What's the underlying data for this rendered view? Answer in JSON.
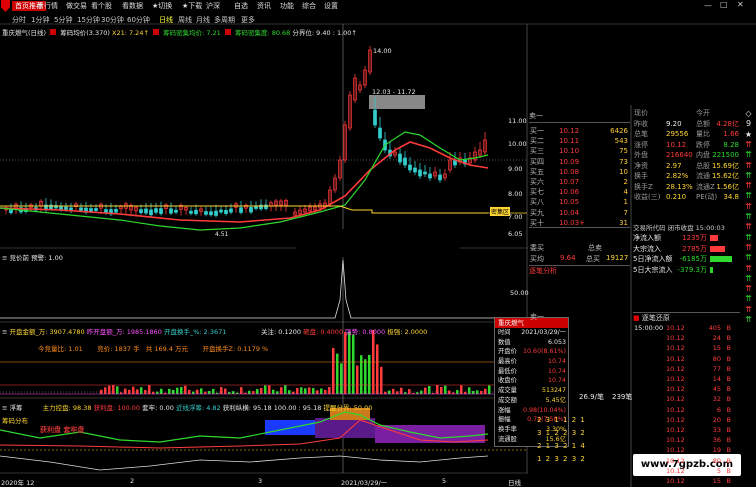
{
  "menu": [
    {
      "label": "首页推荐",
      "active": true
    },
    {
      "label": "看行情",
      "active": false
    },
    {
      "label": "做交易",
      "active": false
    },
    {
      "label": "看个股",
      "active": false
    },
    {
      "label": "看数据",
      "active": false
    },
    {
      "label": "★切换",
      "active": false
    },
    {
      "label": "★下载",
      "active": false
    },
    {
      "label": "沪深",
      "active": false
    },
    {
      "label": "自选",
      "active": false
    },
    {
      "label": "资讯",
      "active": false
    },
    {
      "label": "功能",
      "active": false
    },
    {
      "label": "综合",
      "active": false
    },
    {
      "label": "设置",
      "active": false
    }
  ],
  "periods": [
    "分时",
    "1分钟",
    "5分钟",
    "15分钟",
    "30分钟",
    "60分钟",
    "日线",
    "周线",
    "月线",
    "多周期",
    "更多"
  ],
  "active_period": "日线",
  "main_header": {
    "title": "重庆燃气(日线)",
    "ind1": "筹码均价(3.370)",
    "x21": "X21: 7.24↑",
    "ind2": "筹码密集均价: 7.21",
    "ind3": "筹码密集度: 80.68",
    "fen": "分界位: 9.40 : 1.00↑"
  },
  "price_axis": [
    "11.00",
    "10.00",
    "9.00",
    "8.00",
    "7.00",
    "6.05"
  ],
  "annotations": {
    "high": "14.00",
    "range": "12.03 - 11.72",
    "badge": "密集区",
    "low": "4.51"
  },
  "jingjia": {
    "label": "竞价前",
    "val": "预警: 1.00"
  },
  "axis_50": "50.00",
  "vol_header": {
    "a": "开盘金额_万: 3907.4780",
    "b": "昨开盘额_万: 1985.1860",
    "c": "开盘换手_%: 2.3671",
    "d": "关注: 0.1200",
    "e": "砸盘: 0.4000",
    "f": "强势: 0.8000",
    "g": "极强: 2.0000"
  },
  "vol_sub": {
    "a": "今竞量比: 1.01",
    "b": "竞价: 1837 手",
    "c": "共 169.4 万元",
    "d": "开盘换手Z: 0.1179 %"
  },
  "bot_header": {
    "title": "浮筹",
    "a": "主力控盘: 98.38",
    "b": "获利盘: 100.00",
    "c": "套牢: 0.00",
    "d": "近线浮筹: 4.82",
    "e": "获利纵横: 95.18",
    "f": "100.00 : 95.18",
    "g": "提醒分界: 50.00"
  },
  "bot_left": {
    "a": "筹码分布",
    "b": "获利盘 套牢盘"
  },
  "dates": [
    "2020年 12",
    "2",
    "3",
    "2021/03/29/一",
    "5",
    "日线"
  ],
  "tooltip": {
    "title": "重庆燃气",
    "rows": [
      {
        "k": "时间",
        "v": "2021/03/29/一",
        "c": "wht"
      },
      {
        "k": "数值",
        "v": "6.053",
        "c": "wht"
      },
      {
        "k": "开盘价",
        "v": "10.60(8.61%)",
        "c": "red"
      },
      {
        "k": "最高价",
        "v": "10.74",
        "c": "red"
      },
      {
        "k": "最低价",
        "v": "10.74",
        "c": "red"
      },
      {
        "k": "收盘价",
        "v": "10.74",
        "c": "red"
      },
      {
        "k": "成交量",
        "v": "513247",
        "c": "yel"
      },
      {
        "k": "成交额",
        "v": "5.45亿",
        "c": "yel"
      },
      {
        "k": "涨幅",
        "v": "0.98(10.04%)",
        "c": "red"
      },
      {
        "k": "振幅",
        "v": "0.74(7.58%)",
        "c": "red"
      },
      {
        "k": "换手率",
        "v": "3.30%",
        "c": "yel"
      },
      {
        "k": "流通股",
        "v": "15.6亿",
        "c": "yel"
      }
    ]
  },
  "order_book": {
    "sell_label": "卖一",
    "rows": [
      {
        "l": "买一",
        "p": "10.12",
        "v": "6426"
      },
      {
        "l": "买二",
        "p": "10.11",
        "v": "543"
      },
      {
        "l": "买三",
        "p": "10.10",
        "v": "75"
      },
      {
        "l": "买四",
        "p": "10.09",
        "v": "73"
      },
      {
        "l": "买五",
        "p": "10.08",
        "v": "10"
      },
      {
        "l": "买六",
        "p": "10.07",
        "v": "2"
      },
      {
        "l": "买七",
        "p": "10.06",
        "v": "4"
      },
      {
        "l": "买八",
        "p": "10.05",
        "v": "1"
      },
      {
        "l": "买九",
        "p": "10.04",
        "v": "7"
      },
      {
        "l": "买十",
        "p": "10.03+",
        "v": "31"
      }
    ],
    "wm_l": "委买",
    "wm_r": "总卖",
    "wb_l": "买均",
    "wb_p": "9.64",
    "wb_m": "总买",
    "wb_v": "19127",
    "zbfx": "逐笔分析",
    "bot_lbl": "卖一"
  },
  "stats": [
    {
      "a": "现价",
      "b": "",
      "c": "今开",
      "d": ""
    },
    {
      "a": "昨收",
      "b": "9.20",
      "c": "总额",
      "d": "4.28亿"
    },
    {
      "a": "总笔",
      "b": "29556",
      "c": "量比",
      "d": "1.66"
    },
    {
      "a": "涨停",
      "b": "10.12",
      "c": "跌停",
      "d": "8.28"
    },
    {
      "a": "外盘",
      "b": "216640",
      "c": "内盘",
      "d": "221500"
    },
    {
      "a": "净资",
      "b": "2.97",
      "c": "总股",
      "d": "15.69亿"
    },
    {
      "a": "换手",
      "b": "2.82%",
      "c": "流通",
      "d": "15.62亿"
    },
    {
      "a": "换手Z",
      "b": "28.13%",
      "c": "流通Z",
      "d": "1.56亿"
    },
    {
      "a": "收益(三)",
      "b": "0.210",
      "c": "PE(动)",
      "d": "34.8"
    }
  ],
  "exch": "交易所代码 闭市收盘 15:00:03",
  "flows": [
    {
      "k": "净流入额",
      "v": "1235万",
      "pct": 35,
      "c": "red"
    },
    {
      "k": "大宗流入",
      "v": "2785万",
      "pct": 70,
      "c": "red"
    },
    {
      "k": "5日净流入额",
      "v": "-6185万",
      "pct": 100,
      "c": "grn"
    },
    {
      "k": "5日大宗流入",
      "v": "-379.3万",
      "pct": 15,
      "c": "grn"
    }
  ],
  "zbhy": "逐笔还原",
  "ticks": [
    {
      "t": "15:00:00",
      "p": "10.12",
      "v": "405"
    },
    {
      "t": "",
      "p": "10.12",
      "v": "24"
    },
    {
      "t": "",
      "p": "10.12",
      "v": "15"
    },
    {
      "t": "",
      "p": "10.12",
      "v": "80"
    },
    {
      "t": "",
      "p": "10.12",
      "v": "77"
    },
    {
      "t": "",
      "p": "10.12",
      "v": "14"
    },
    {
      "t": "",
      "p": "10.12",
      "v": "45"
    },
    {
      "t": "",
      "p": "10.12",
      "v": "32"
    },
    {
      "t": "",
      "p": "10.12",
      "v": "6"
    },
    {
      "t": "",
      "p": "10.12",
      "v": "20"
    },
    {
      "t": "",
      "p": "10.12",
      "v": "33"
    },
    {
      "t": "",
      "p": "10.12",
      "v": "36"
    },
    {
      "t": "",
      "p": "10.12",
      "v": "19"
    },
    {
      "t": "",
      "p": "10.12",
      "v": "80"
    },
    {
      "t": "",
      "p": "10.12",
      "v": "5"
    },
    {
      "t": "",
      "p": "10.12",
      "v": "15"
    }
  ],
  "tail": {
    "a": "26.9/笔",
    "b": "239笔"
  },
  "tail_rows": [
    "2  3  1  1  2  1",
    "3  1  2  2  3  2",
    "2  1  3  2  1  4",
    "1  2  3  2  3  2"
  ],
  "watermark": "www.7gpzb.com",
  "side_icons": [
    "◇",
    "9",
    "★",
    "⇈",
    "⇈",
    "⇈",
    "⇈",
    "⇈",
    "⇈",
    "⇈",
    "⇈",
    "⇈",
    "⇈",
    "⇈",
    "⇈",
    "⇈",
    "⇈",
    "⇈",
    "⇈",
    "⇈",
    "⇈"
  ],
  "colors": {
    "up": "#ff3b3b",
    "down": "#2ed82e",
    "ma_yellow": "#ffd633",
    "accent": "#cc0000"
  }
}
